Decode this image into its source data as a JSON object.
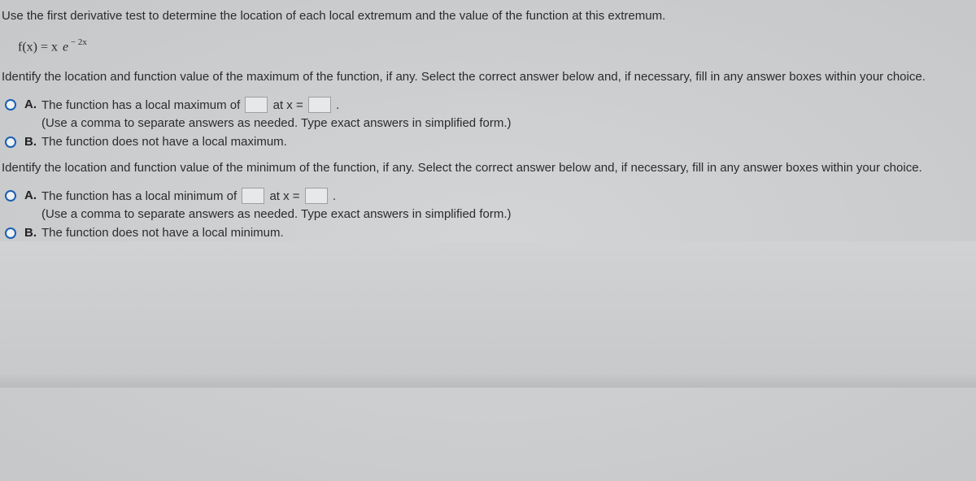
{
  "intro": "Use the first derivative test to determine the location of each local extremum and the value of the function at this extremum.",
  "equation": {
    "lhs": "f(x) = x",
    "e": "e",
    "exp": " − 2x"
  },
  "q_max": "Identify the location and function value of the maximum of the function, if any. Select the correct answer below and, if necessary, fill in any answer boxes within your choice.",
  "max_a": {
    "letter": "A.",
    "pre": "The function has a local maximum of ",
    "mid": " at x = ",
    "post": " .",
    "hint": "(Use a comma to separate answers as needed. Type exact answers in simplified form.)"
  },
  "max_b": {
    "letter": "B.",
    "text": "The function does not have a local maximum."
  },
  "q_min": "Identify the location and function value of the minimum of the function, if any. Select the correct answer below and, if necessary, fill in any answer boxes within your choice.",
  "min_a": {
    "letter": "A.",
    "pre": "The function has a local minimum of ",
    "mid": " at x = ",
    "post": " .",
    "hint": "(Use a comma to separate answers as needed. Type exact answers in simplified form.)"
  },
  "min_b": {
    "letter": "B.",
    "text": "The function does not have a local minimum."
  }
}
